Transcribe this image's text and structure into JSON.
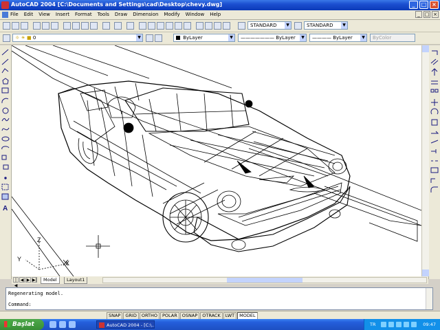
{
  "window": {
    "title": "AutoCAD 2004   [C:\\Documents and Settings\\cad\\Desktop\\chevy.dwg]",
    "controls": [
      "_",
      "□",
      "×"
    ]
  },
  "menubar": {
    "items": [
      "File",
      "Edit",
      "View",
      "Insert",
      "Format",
      "Tools",
      "Draw",
      "Dimension",
      "Modify",
      "Window",
      "Help"
    ],
    "mdi_controls": [
      "_",
      "□",
      "×"
    ]
  },
  "toolbar": {
    "text_style": "STANDARD",
    "dim_style": "STANDARD",
    "layer": "0",
    "color": "ByLayer",
    "linetype": "ByLayer",
    "lineweight": "ByLayer",
    "plotstyle": "ByColor"
  },
  "layout_tabs": [
    "Model",
    "Layout1"
  ],
  "ucs": {
    "x": "X",
    "y": "Y",
    "z": "Z"
  },
  "command_window": {
    "history": "Regenerating model.",
    "prompt": "Command:"
  },
  "status": {
    "toggles": [
      "SNAP",
      "GRID",
      "ORTHO",
      "POLAR",
      "OSNAP",
      "OTRACK",
      "LWT",
      "MODEL"
    ],
    "active": "MODEL"
  },
  "taskbar": {
    "start_label": "Başlat",
    "task_label": "AutoCAD 2004 - [C:\\...",
    "language": "TR",
    "clock": "09:47"
  },
  "colors": {
    "titlebar": "#1c4fd0",
    "chrome": "#ece9d8",
    "canvas": "#ffffff",
    "wire": "#000000"
  }
}
